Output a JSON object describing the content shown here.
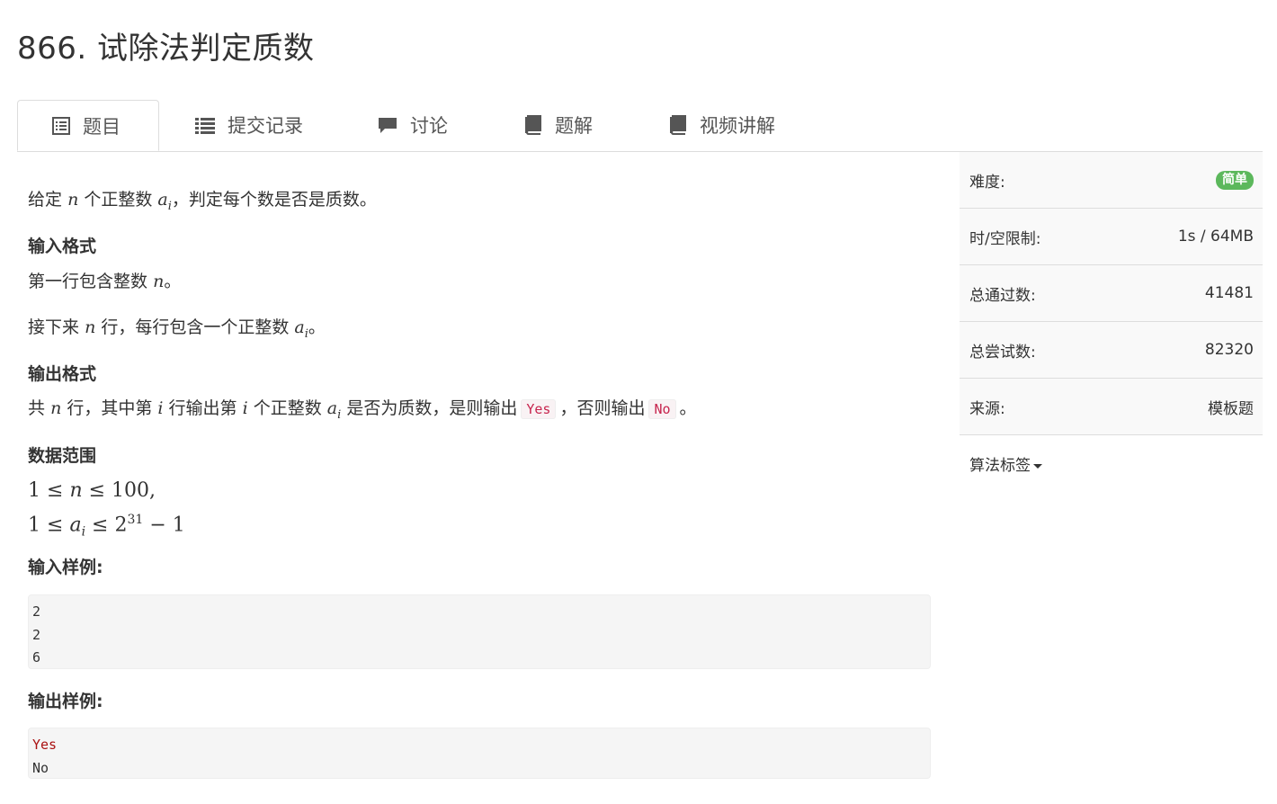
{
  "problem": {
    "title": "866. 试除法判定质数"
  },
  "tabs": [
    {
      "label": "题目",
      "icon": "list-alt-icon"
    },
    {
      "label": "提交记录",
      "icon": "list-icon"
    },
    {
      "label": "讨论",
      "icon": "comment-icon"
    },
    {
      "label": "题解",
      "icon": "book-icon"
    },
    {
      "label": "视频讲解",
      "icon": "book-icon"
    }
  ],
  "statement": {
    "intro_pre": "给定",
    "intro_n": "n",
    "intro_mid": "个正整数",
    "intro_a": "a",
    "intro_sub": "i",
    "intro_post": "，判定每个数是否是质数。"
  },
  "input_format": {
    "heading": "输入格式",
    "line1_pre": "第一行包含整数",
    "line1_n": "n",
    "line1_post": "。",
    "line2_pre": "接下来",
    "line2_n": "n",
    "line2_mid": "行，每行包含一个正整数",
    "line2_a": "a",
    "line2_sub": "i",
    "line2_post": "。"
  },
  "output_format": {
    "heading": "输出格式",
    "t1": "共",
    "n": "n",
    "t2": "行，其中第",
    "i1": "i",
    "t3": "行输出第",
    "i2": "i",
    "t4": "个正整数",
    "a": "a",
    "sub": "i",
    "t5": "是否为质数，是则输出",
    "yes": "Yes",
    "t6": "，否则输出",
    "no": "No",
    "t7": "。"
  },
  "range": {
    "heading": "数据范围",
    "line1": {
      "one": "1",
      "le1": "≤",
      "n": "n",
      "le2": "≤",
      "max": "100",
      "comma": ","
    },
    "line2": {
      "one": "1",
      "le1": "≤",
      "a": "a",
      "sub": "i",
      "le2": "≤",
      "base": "2",
      "exp": "31",
      "minus": "−",
      "tail": "1"
    }
  },
  "sample_input": {
    "heading": "输入样例:",
    "lines": [
      "2",
      "2",
      "6"
    ]
  },
  "sample_output": {
    "heading": "输出样例:",
    "lines": [
      "Yes",
      "No"
    ]
  },
  "sidebar": {
    "difficulty_label": "难度:",
    "difficulty_value": "简单",
    "limit_label": "时/空限制:",
    "limit_value": "1s / 64MB",
    "passed_label": "总通过数:",
    "passed_value": "41481",
    "tried_label": "总尝试数:",
    "tried_value": "82320",
    "source_label": "来源:",
    "source_value": "模板题",
    "tags_label": "算法标签"
  },
  "colors": {
    "badge": "#5cb85c",
    "inline_code": "#c7254e"
  }
}
